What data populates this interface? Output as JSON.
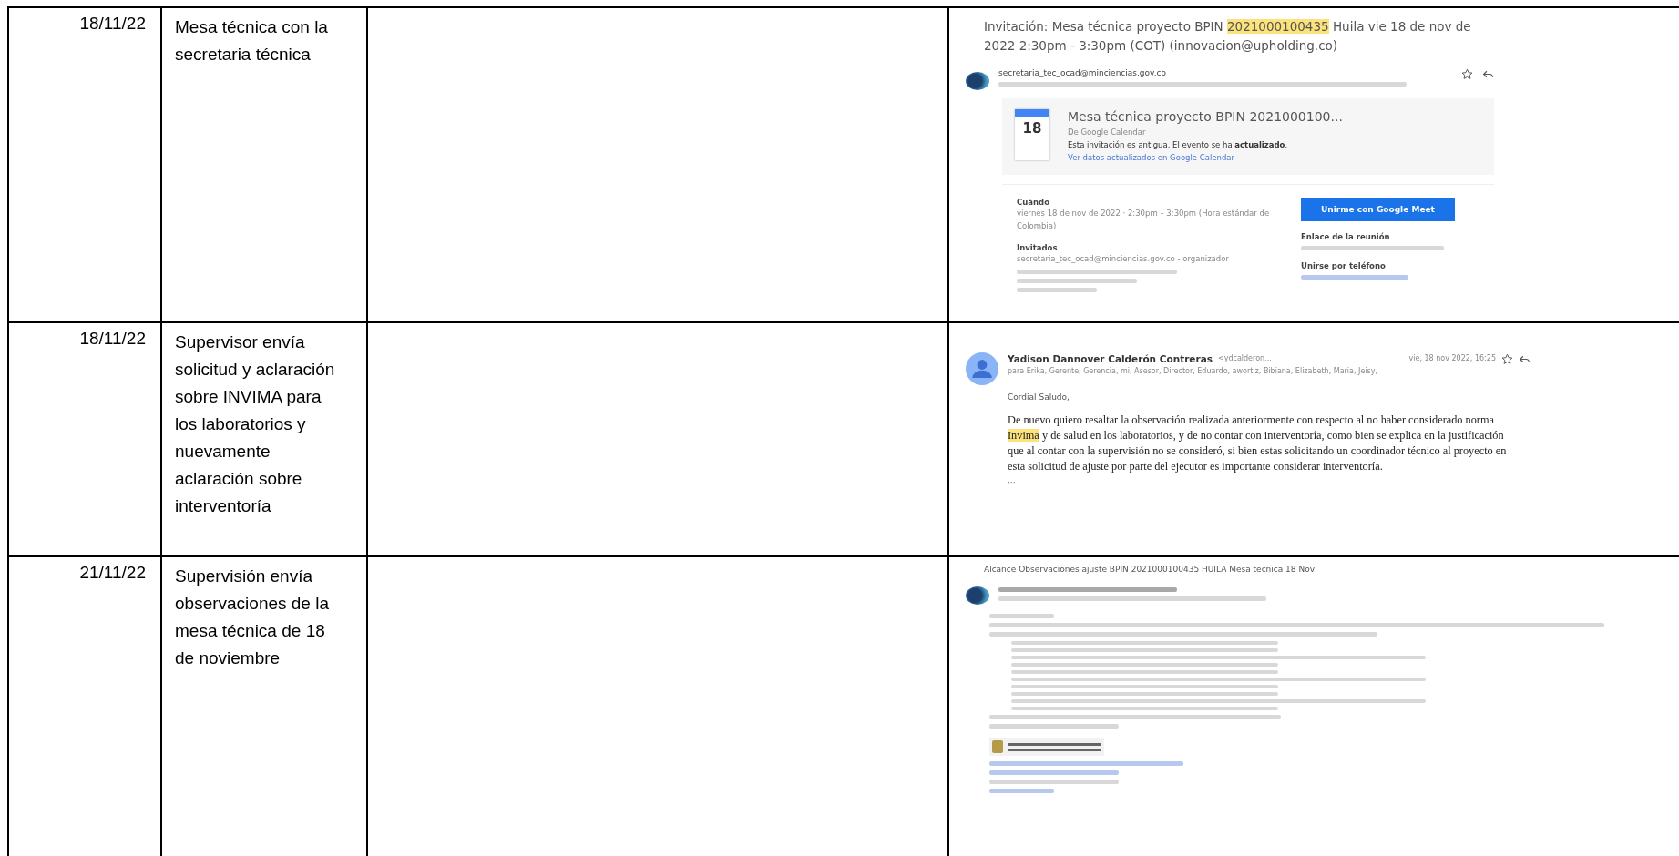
{
  "rows": [
    {
      "date": "18/11/22",
      "description": "Mesa técnica con la secretaria técnica",
      "kind": "invitation"
    },
    {
      "date": "18/11/22",
      "description": "Supervisor envía solicitud y aclaración sobre INVIMA para los laboratorios y nuevamente aclaración sobre interventoría",
      "kind": "reply"
    },
    {
      "date": "21/11/22",
      "description": "Supervisión envía observaciones de la mesa técnica de 18 de noviembre",
      "kind": "notice"
    }
  ],
  "invitation": {
    "subject_before": "Invitación: Mesa técnica proyecto BPIN ",
    "subject_highlight": "2021000100435",
    "subject_after": " Huila vie 18 de nov de 2022 2:30pm - 3:30pm (COT) (innovacion@upholding.co)",
    "sender": "secretaria_tec_ocad@minciencias.gov.co",
    "event": {
      "day": "18",
      "title": "Mesa técnica proyecto BPIN 2021000100...",
      "source": "De Google Calendar",
      "notice": "Esta invitación es antigua. El evento se ha **actualizado**.",
      "link": "Ver datos actualizados en Google Calendar"
    },
    "when_label": "Cuándo",
    "when": "viernes 18 de nov de 2022 · 2:30pm – 3:30pm (Hora estándar de Colombia)",
    "guests_label": "Invitados",
    "guests": [
      "secretaria_tec_ocad@minciencias.gov.co - organizador"
    ],
    "meet_button": "Unirme con Google Meet",
    "link_label": "Enlace de la reunión",
    "phone_label": "Unirse por teléfono"
  },
  "reply": {
    "sender": "Yadison Dannover Calderón Contreras",
    "sender_address": "<ydcalderon...",
    "date": "vie, 18 nov 2022, 16:25",
    "recipients": "para Erika, Gerente, Gerencia, mi, Asesor, Director, Eduardo, awortiz, Bibiana, Elizabeth, Maria, Jeisy,",
    "greeting": "Cordial Saludo,",
    "body_before": "De nuevo quiero resaltar la observación realizada anteriormente con respecto al no haber considerado norma ",
    "body_highlight": "Invima",
    "body_after": " y de salud en los laboratorios, y de no contar con interventoría, como bien se explica en la justificación que al  contar con la supervisión no se consideró, si bien estas solicitando un coordinador técnico al proyecto en esta solicitud de ajuste por parte del ejecutor es importante considerar interventoría.",
    "more": "···"
  },
  "notice": {
    "subject": "Alcance Observaciones ajuste BPIN 2021000100435 HUILA Mesa tecnica 18 Nov"
  }
}
